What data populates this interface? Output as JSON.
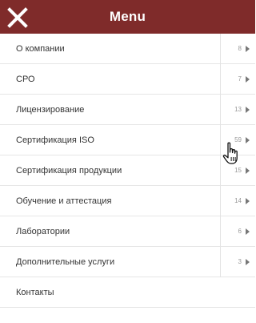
{
  "header": {
    "title": "Menu",
    "close_icon": "close-icon",
    "background_color": "#7f2b2a"
  },
  "menu": {
    "items": [
      {
        "label": "О компании",
        "count": "8"
      },
      {
        "label": "СРО",
        "count": "7"
      },
      {
        "label": "Лицензирование",
        "count": "13"
      },
      {
        "label": "Сертификация ISO",
        "count": "59"
      },
      {
        "label": "Сертификация продукции",
        "count": "15"
      },
      {
        "label": "Обучение и аттестация",
        "count": "14"
      },
      {
        "label": "Лаборатории",
        "count": "6"
      },
      {
        "label": "Дополнительные услуги",
        "count": "3"
      },
      {
        "label": "Контакты"
      }
    ]
  },
  "cursor": {
    "icon": "hand-pointer-icon"
  }
}
